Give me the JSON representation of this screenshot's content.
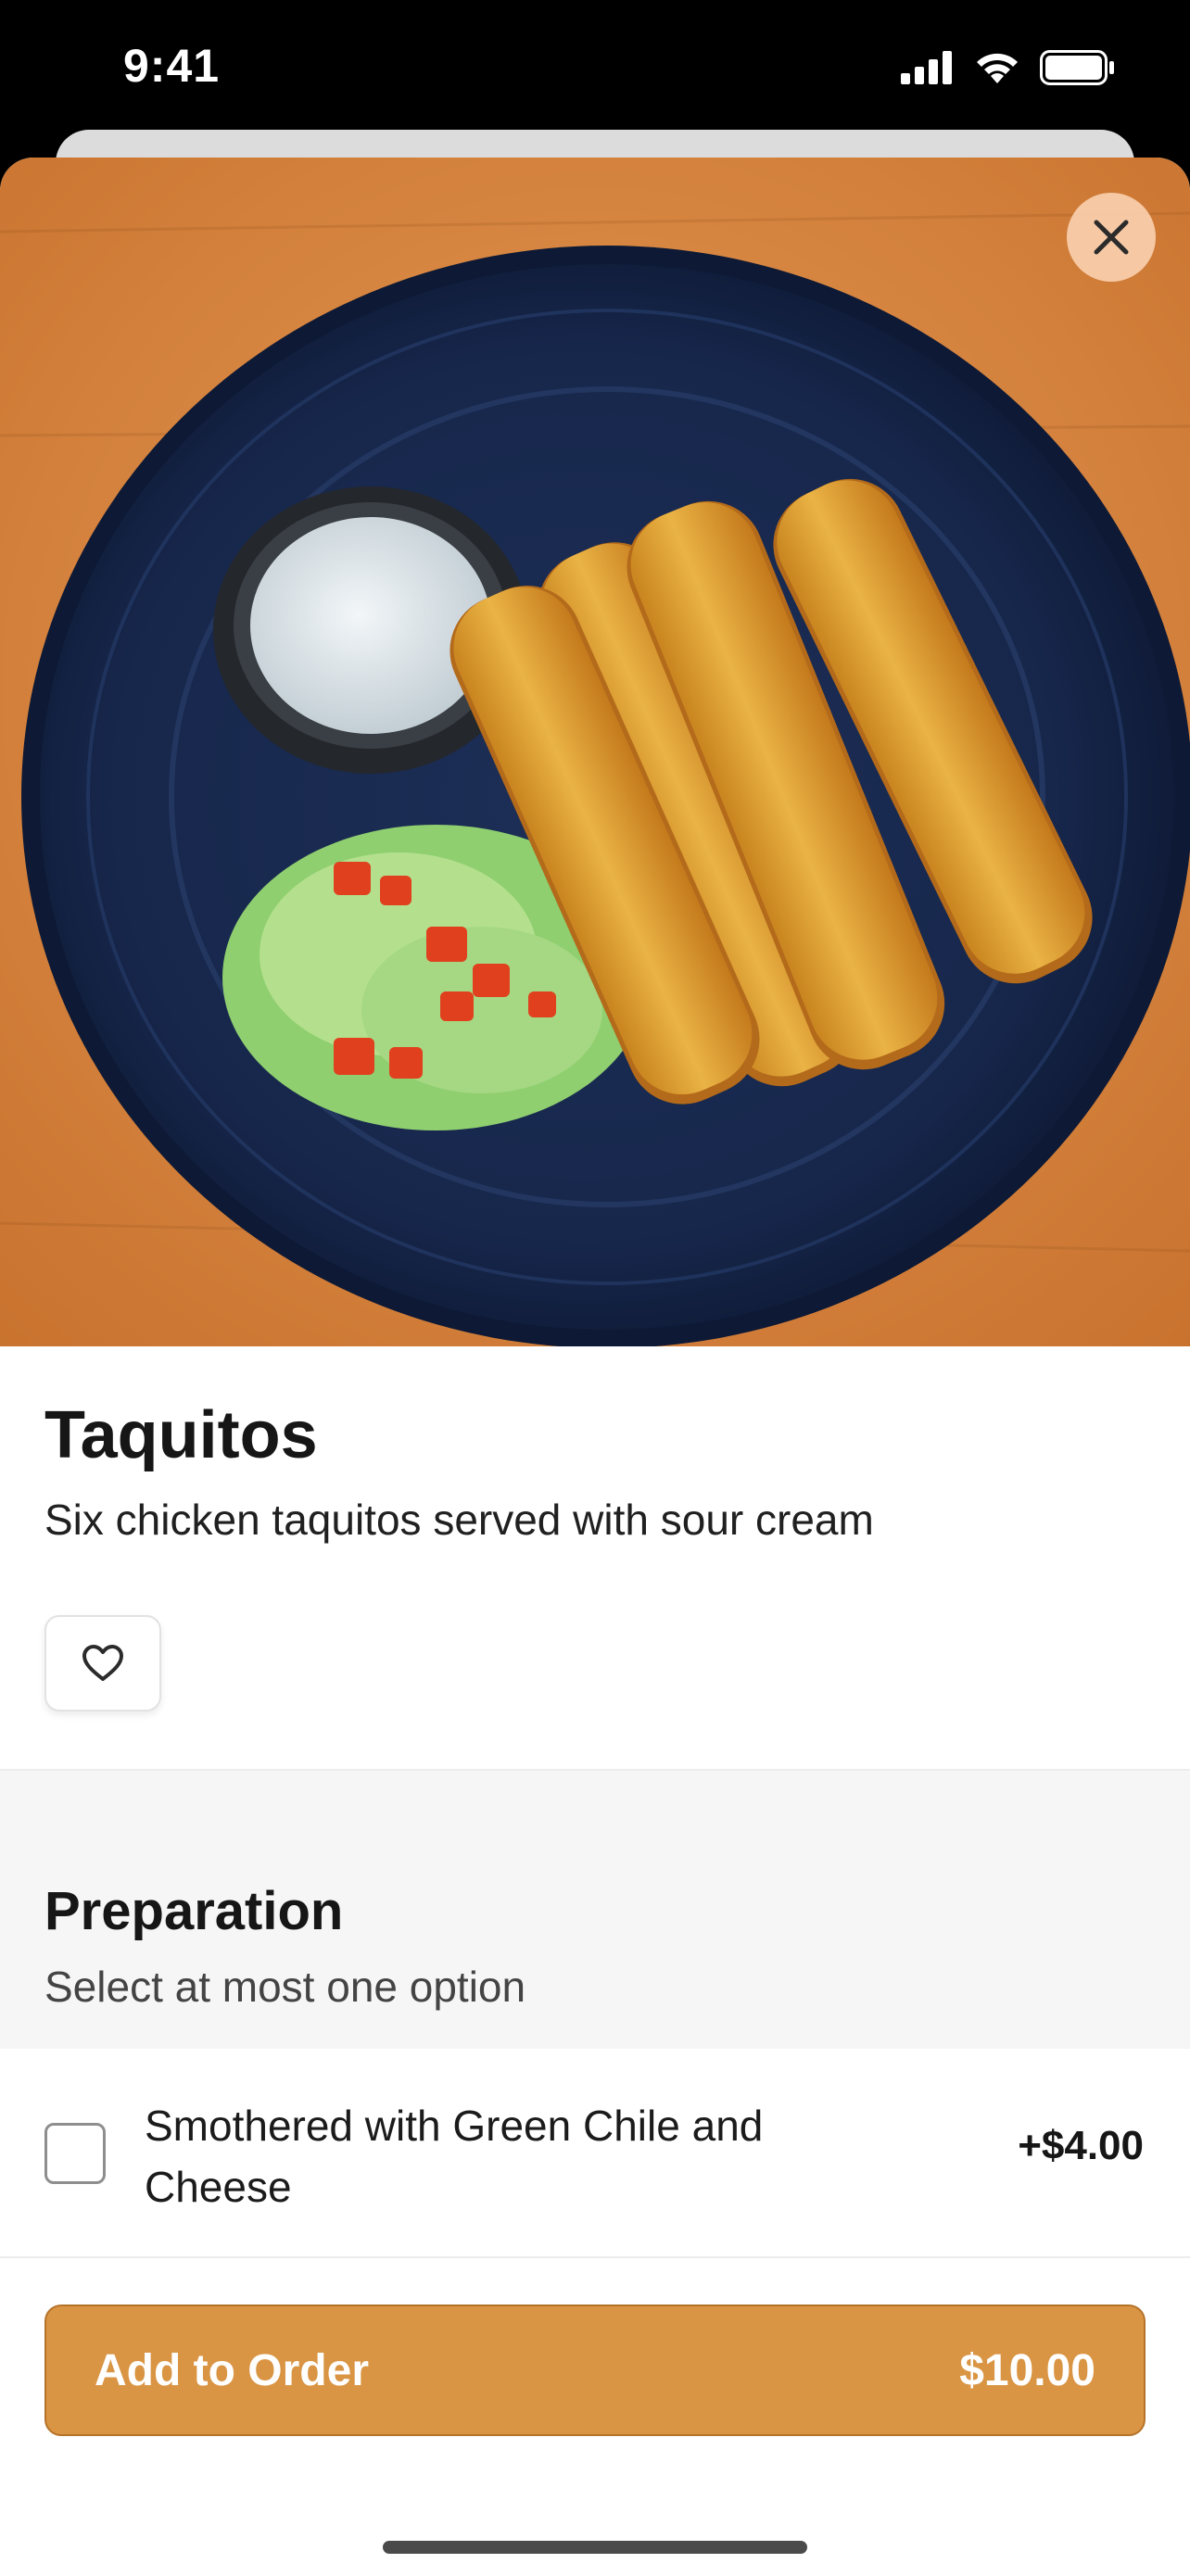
{
  "status_bar": {
    "time": "9:41",
    "signal_icon": "cellular-signal-icon",
    "wifi_icon": "wifi-icon",
    "battery_icon": "battery-icon"
  },
  "hero": {
    "image": "taquitos-plate-photo",
    "close_icon": "close-icon"
  },
  "item": {
    "title": "Taquitos",
    "description": "Six chicken taquitos served with sour cream",
    "favorite_icon": "heart-icon"
  },
  "preparation": {
    "title": "Preparation",
    "subtitle": "Select at most one option",
    "options": [
      {
        "label": "Smothered with Green Chile and Cheese",
        "price": "+$4.00",
        "checked": false
      }
    ]
  },
  "footer": {
    "add_label": "Add to Order",
    "total": "$10.00"
  },
  "colors": {
    "accent": "#d99543",
    "close_button_bg": "#f8ccaa",
    "section_bg": "#f6f6f6"
  }
}
